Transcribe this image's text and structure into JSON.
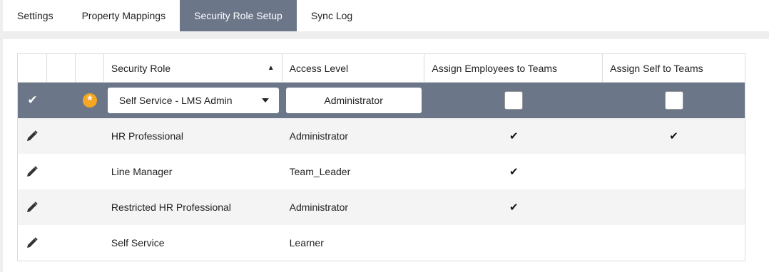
{
  "tabs": [
    {
      "label": "Settings",
      "active": false
    },
    {
      "label": "Property Mappings",
      "active": false
    },
    {
      "label": "Security Role Setup",
      "active": true
    },
    {
      "label": "Sync Log",
      "active": false
    }
  ],
  "grid": {
    "columns": {
      "security_role": "Security Role",
      "access_level": "Access Level",
      "assign_employees": "Assign Employees to Teams",
      "assign_self": "Assign Self to Teams"
    },
    "edit_row": {
      "security_role_selected": "Self Service - LMS Admin",
      "access_level_value": "Administrator",
      "assign_employees_checked": false,
      "assign_self_checked": false
    },
    "rows": [
      {
        "security_role": "HR Professional",
        "access_level": "Administrator",
        "assign_employees": "✔",
        "assign_self": "✔"
      },
      {
        "security_role": "Line Manager",
        "access_level": "Team_Leader",
        "assign_employees": "✔",
        "assign_self": ""
      },
      {
        "security_role": "Restricted HR Professional",
        "access_level": "Administrator",
        "assign_employees": "✔",
        "assign_self": ""
      },
      {
        "security_role": "Self Service",
        "access_level": "Learner",
        "assign_employees": "",
        "assign_self": ""
      }
    ]
  },
  "icons": {
    "save": "check-icon",
    "new_record": "asterisk-icon",
    "edit": "pencil-icon",
    "sort": "sort-ascending-icon"
  },
  "colors": {
    "accent": "#6b7689",
    "badge": "#f5a623",
    "alt_row": "#f4f4f4"
  }
}
